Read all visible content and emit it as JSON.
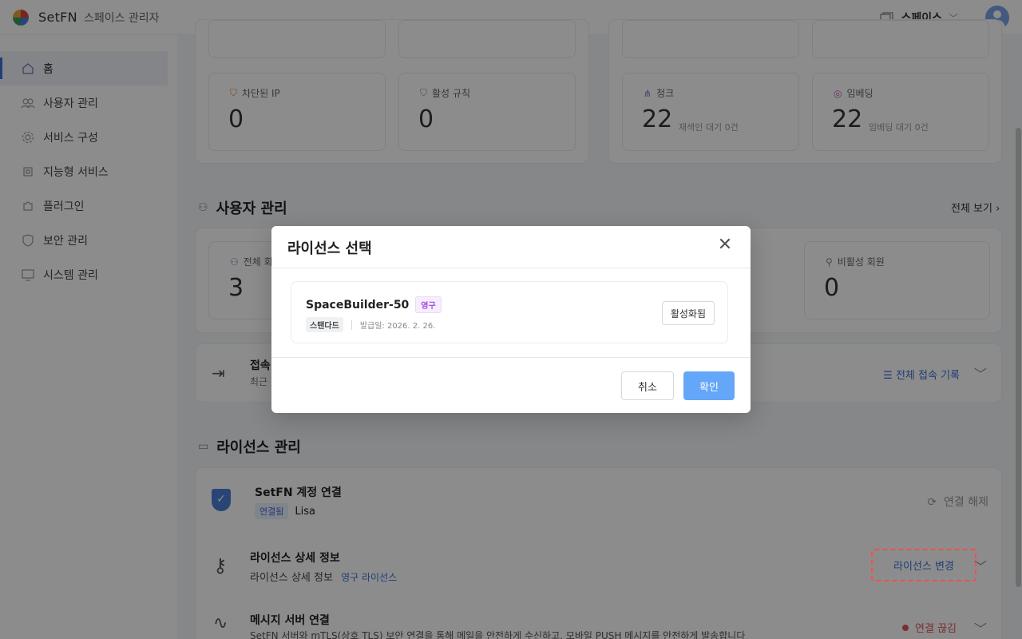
{
  "header": {
    "brand": "SetFN",
    "subtitle": "스페이스 관리자",
    "space_label": "스페이스"
  },
  "sidebar": {
    "items": [
      {
        "label": "홈",
        "icon": "home-icon"
      },
      {
        "label": "사용자 관리",
        "icon": "users-icon"
      },
      {
        "label": "서비스 구성",
        "icon": "gear-icon"
      },
      {
        "label": "지능형 서비스",
        "icon": "chip-icon"
      },
      {
        "label": "플러그인",
        "icon": "puzzle-icon"
      },
      {
        "label": "보안 관리",
        "icon": "shield-icon"
      },
      {
        "label": "시스템 관리",
        "icon": "monitor-icon"
      }
    ]
  },
  "security_stats": [
    {
      "label": "차단된 IP",
      "value": "0"
    },
    {
      "label": "활성 규칙",
      "value": "0"
    }
  ],
  "data_stats": [
    {
      "label": "청크",
      "value": "22",
      "sub": "재색인 대기 0건"
    },
    {
      "label": "임베딩",
      "value": "22",
      "sub": "임베딩 대기 0건"
    }
  ],
  "users_section": {
    "title": "사용자 관리",
    "see_all": "전체 보기",
    "total_label": "전체 회",
    "total_value": "3",
    "inactive_label": "비활성 회원",
    "inactive_value": "0"
  },
  "access_log": {
    "title": "접속",
    "subtitle": "최근",
    "link": "전체 접속 기록"
  },
  "license_section": {
    "title": "라이선스 관리",
    "account_title": "SetFN 계정 연결",
    "account_status": "연결됨",
    "account_user": "Lisa",
    "disconnect": "연결 해제",
    "detail_title": "라이선스 상세 정보",
    "detail_sub": "라이선스 상세 정보",
    "detail_type": "영구 라이선스",
    "change_button": "라이선스 변경",
    "msg_title": "메시지 서버 연결",
    "msg_sub": "SetFN 서버와 mTLS(상호 TLS) 보안 연결을 통해 메일을 안전하게 수신하고, 모바일 PUSH 메시지를 안전하게 발송합니다",
    "msg_status": "연결 끊김"
  },
  "modal": {
    "title": "라이선스 선택",
    "license_name": "SpaceBuilder-50",
    "license_tag": "영구",
    "license_tier": "스탠다드",
    "issued": "발급일: 2026. 2. 26.",
    "activated_button": "활성화됨",
    "cancel": "취소",
    "confirm": "확인"
  },
  "colors": {
    "accent": "#3b6fd8",
    "confirm": "#64a6f7",
    "highlight": "#ff4d4d",
    "disconnected": "#e05555"
  }
}
